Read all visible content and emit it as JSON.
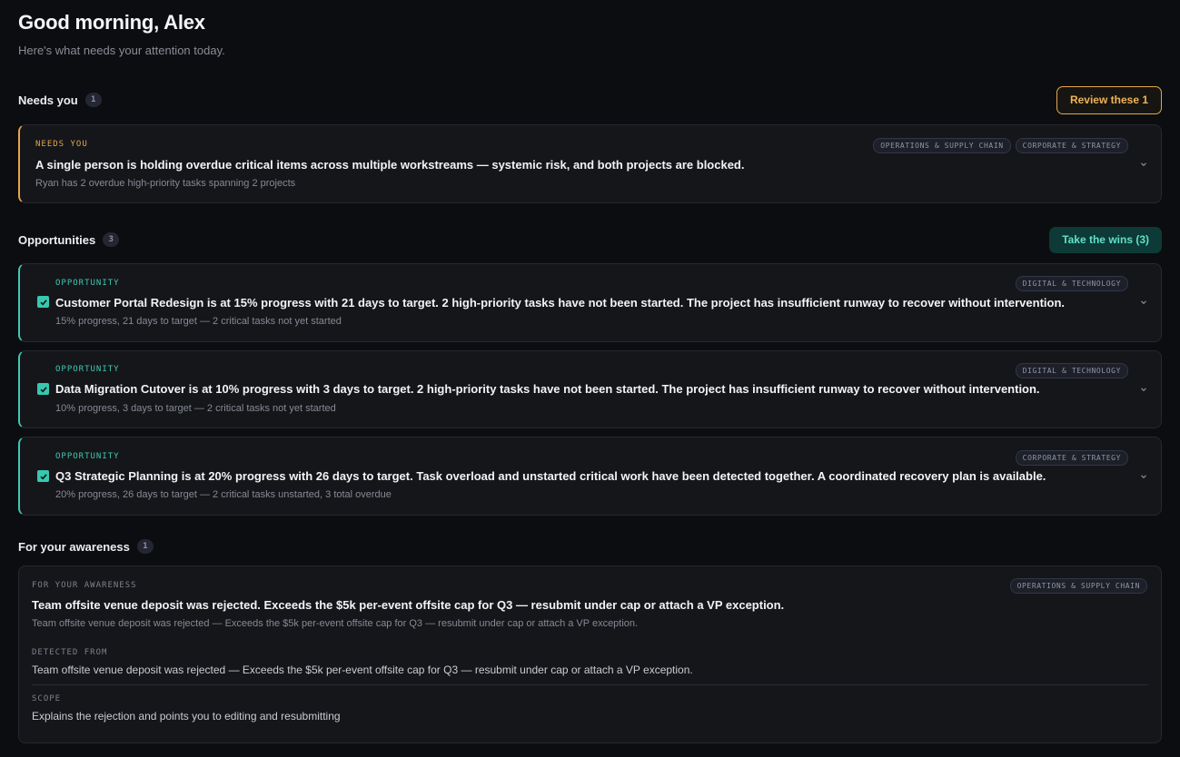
{
  "header": {
    "greeting": "Good morning, Alex",
    "subtitle": "Here's what needs your attention today."
  },
  "needs_you": {
    "title": "Needs you",
    "count": "1",
    "action_label": "Review these 1",
    "cards": [
      {
        "kicker": "NEEDS YOU",
        "tags": [
          "OPERATIONS & SUPPLY CHAIN",
          "CORPORATE & STRATEGY"
        ],
        "title": "A single person is holding overdue critical items across multiple workstreams — systemic risk, and both projects are blocked.",
        "subtitle": "Ryan has 2 overdue high-priority tasks spanning 2 projects"
      }
    ]
  },
  "opportunities": {
    "title": "Opportunities",
    "count": "3",
    "action_label": "Take the wins (3)",
    "cards": [
      {
        "kicker": "OPPORTUNITY",
        "tags": [
          "DIGITAL & TECHNOLOGY"
        ],
        "checked": true,
        "title": "Customer Portal Redesign is at 15% progress with 21 days to target. 2 high-priority tasks have not been started. The project has insufficient runway to recover without intervention.",
        "subtitle": "15% progress, 21 days to target — 2 critical tasks not yet started"
      },
      {
        "kicker": "OPPORTUNITY",
        "tags": [
          "DIGITAL & TECHNOLOGY"
        ],
        "checked": true,
        "title": "Data Migration Cutover is at 10% progress with 3 days to target. 2 high-priority tasks have not been started. The project has insufficient runway to recover without intervention.",
        "subtitle": "10% progress, 3 days to target — 2 critical tasks not yet started"
      },
      {
        "kicker": "OPPORTUNITY",
        "tags": [
          "CORPORATE & STRATEGY"
        ],
        "checked": true,
        "title": "Q3 Strategic Planning is at 20% progress with 26 days to target. Task overload and unstarted critical work have been detected together. A coordinated recovery plan is available.",
        "subtitle": "20% progress, 26 days to target — 2 critical tasks unstarted, 3 total overdue"
      }
    ]
  },
  "awareness": {
    "title": "For your awareness",
    "count": "1",
    "card": {
      "kicker": "FOR YOUR AWARENESS",
      "tags": [
        "OPERATIONS & SUPPLY CHAIN"
      ],
      "title": "Team offsite venue deposit was rejected. Exceeds the $5k per-event offsite cap for Q3 — resubmit under cap or attach a VP exception.",
      "subtitle": "Team offsite venue deposit was rejected — Exceeds the $5k per-event offsite cap for Q3 — resubmit under cap or attach a VP exception.",
      "detected_label": "DETECTED FROM",
      "detected_text": "Team offsite venue deposit was rejected — Exceeds the $5k per-event offsite cap for Q3 — resubmit under cap or attach a VP exception.",
      "scope_label": "SCOPE",
      "scope_text": "Explains the rejection and points you to editing and resubmitting"
    }
  },
  "colors": {
    "background": "#0c0d10",
    "card": "#15161a",
    "amber": "#e3a64a",
    "teal": "#3fc9b2"
  },
  "icons": {
    "expand": "chevron-down-icon",
    "checkbox": "check-icon"
  }
}
